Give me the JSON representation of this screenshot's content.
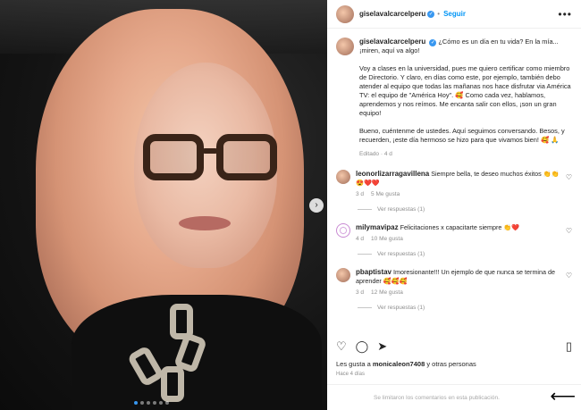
{
  "header": {
    "username": "giselavalcarcelperu",
    "follow_label": "Seguir",
    "more_label": "•••"
  },
  "post": {
    "username": "giselavalcarcelperu",
    "intro": "¿Cómo es un día en tu vida? En la mía... ¡miren, aquí va algo!",
    "para1": "Voy a clases en la universidad, pues me quiero certificar como miembro de Directorio. Y claro, en días como este, por ejemplo, también debo atender al equipo que todas las mañanas nos hace disfrutar via América TV: el equipo de \"América Hoy\". 🥰 Como cada vez, hablamos, aprendemos y nos reímos. Me encanta salir con ellos, ¡son un gran equipo!",
    "para2": "Bueno, cuéntenme de ustedes. Aquí seguimos conversando. Besos, y recuerden, ¡este día hermoso se hizo para que vivamos bien! 🥰 🙏",
    "meta": "Editado · 4 d"
  },
  "comments": [
    {
      "username": "leonorlizarragavillena",
      "text": "Siempre bella, te deseo muchos éxitos 👏👏😍❤️❤️",
      "age": "3 d",
      "likes": "5 Me gusta",
      "replies": "Ver respuestas (1)"
    },
    {
      "username": "milymavipaz",
      "text": "Felicitaciones x capacitarte siempre 👏❤️",
      "age": "4 d",
      "likes": "10 Me gusta",
      "replies": "Ver respuestas (1)"
    },
    {
      "username": "pbaptistav",
      "text": "Imoresionante!!! Un ejemplo de que nunca se termina de aprender 🥰🥰🥰",
      "age": "3 d",
      "likes": "12 Me gusta",
      "replies": "Ver respuestas (1)"
    }
  ],
  "likes_line": {
    "prefix": "Les gusta a",
    "user": "monicaleon7408",
    "suffix": "y otras personas"
  },
  "time_ago": "Hace 4 días",
  "footer": "Se limitaron los comentarios en esta publicación.",
  "carousel": {
    "count": 6,
    "active": 0
  }
}
